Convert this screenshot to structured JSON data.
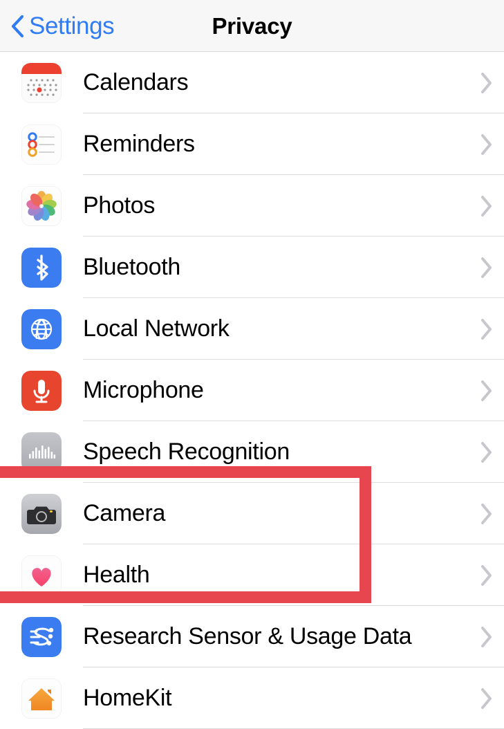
{
  "navbar": {
    "back_label": "Settings",
    "back_icon": "chevron-left-icon",
    "title": "Privacy",
    "accent_color": "#2f7cf6",
    "background_color": "#f7f7f7"
  },
  "list": {
    "chevron_icon": "chevron-right-icon",
    "chevron_color": "#c7c7cc",
    "separator_color": "#dcdcdc",
    "rows": [
      {
        "label": "Calendars",
        "icon": "calendar-icon"
      },
      {
        "label": "Reminders",
        "icon": "reminders-icon"
      },
      {
        "label": "Photos",
        "icon": "photos-icon"
      },
      {
        "label": "Bluetooth",
        "icon": "bluetooth-icon"
      },
      {
        "label": "Local Network",
        "icon": "globe-icon"
      },
      {
        "label": "Microphone",
        "icon": "microphone-icon"
      },
      {
        "label": "Speech Recognition",
        "icon": "speech-recognition-icon"
      },
      {
        "label": "Camera",
        "icon": "camera-icon"
      },
      {
        "label": "Health",
        "icon": "heart-icon"
      },
      {
        "label": "Research Sensor & Usage Data",
        "icon": "research-sensor-icon"
      },
      {
        "label": "HomeKit",
        "icon": "homekit-icon"
      }
    ]
  },
  "annotation": {
    "shape": "rectangle-highlight",
    "color": "#e8464e",
    "highlighted_row": "Camera"
  }
}
